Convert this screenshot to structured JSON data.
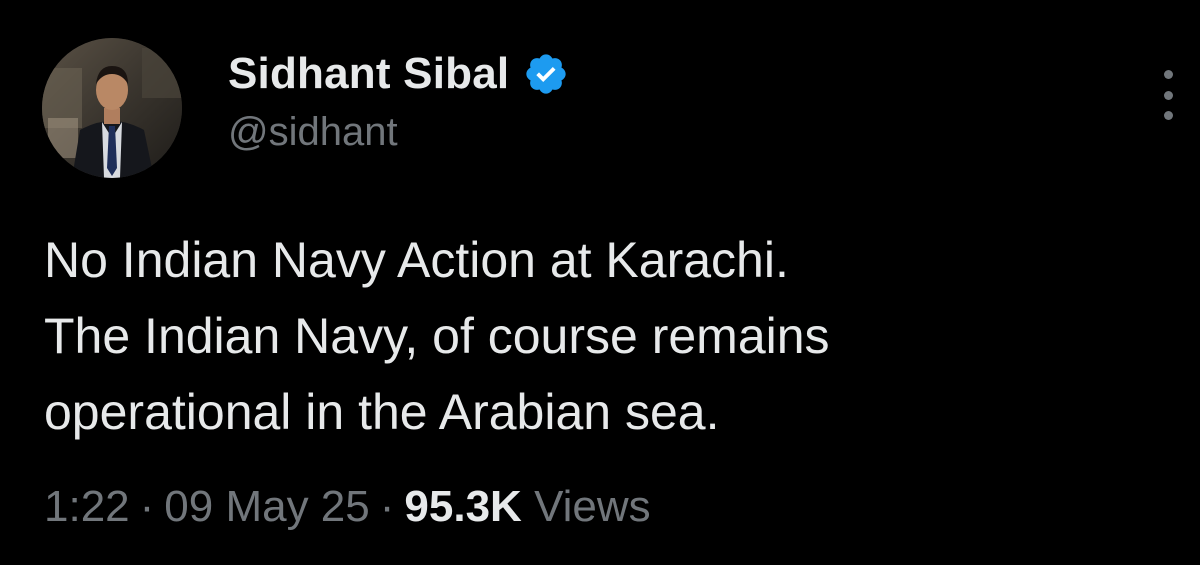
{
  "tweet": {
    "author": {
      "display_name": "Sidhant Sibal",
      "handle": "@sidhant",
      "verified_icon": "verified-badge-icon",
      "verified_color": "#1d9bf0"
    },
    "more_icon": "more-vertical-icon",
    "text_lines": [
      "No Indian Navy Action at Karachi.",
      "The Indian Navy, of course remains",
      "operational in the Arabian sea."
    ],
    "meta": {
      "time": "1:22",
      "separator": "·",
      "date": "09 May 25",
      "views_count": "95.3K",
      "views_label": "Views"
    }
  },
  "colors": {
    "background": "#000000",
    "primary_text": "#e7e9ea",
    "secondary_text": "#71767b"
  }
}
